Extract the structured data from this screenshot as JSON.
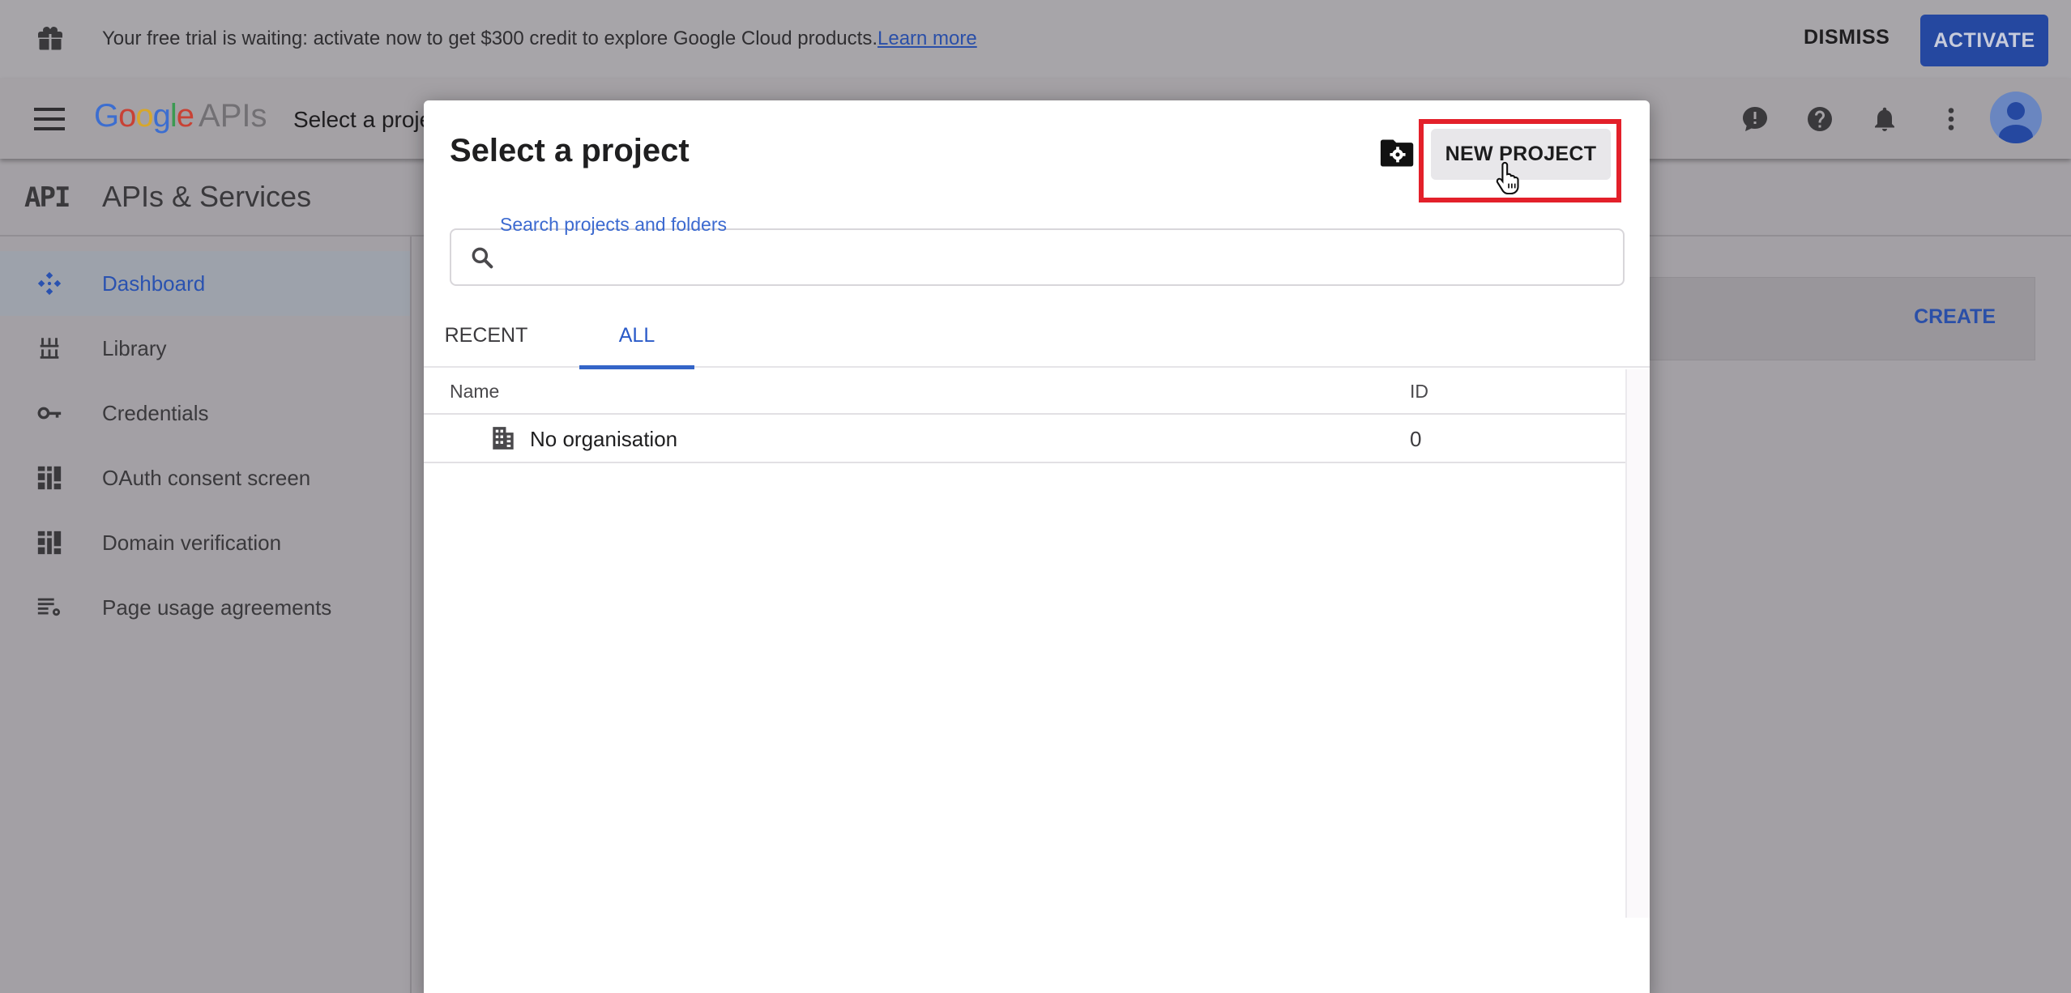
{
  "banner": {
    "message": "Your free trial is waiting: activate now to get $300 credit to explore Google Cloud products.",
    "learn_more": "Learn more",
    "dismiss": "DISMISS",
    "activate": "ACTIVATE"
  },
  "topbar": {
    "logo_google": [
      "G",
      "o",
      "o",
      "g",
      "l",
      "e"
    ],
    "logo_suffix": "APIs",
    "project_selector": "Select a proje",
    "icons": [
      "feedback-icon",
      "help-icon",
      "notifications-icon",
      "more-vert-icon",
      "account-avatar"
    ]
  },
  "subheader": {
    "badge": "API",
    "title": "APIs & Services"
  },
  "sidebar": {
    "items": [
      {
        "label": "Dashboard",
        "icon": "dashboard-icon",
        "active": true
      },
      {
        "label": "Library",
        "icon": "library-icon",
        "active": false
      },
      {
        "label": "Credentials",
        "icon": "key-icon",
        "active": false
      },
      {
        "label": "OAuth consent screen",
        "icon": "oauth-icon",
        "active": false
      },
      {
        "label": "Domain verification",
        "icon": "domain-verification-icon",
        "active": false
      },
      {
        "label": "Page usage agreements",
        "icon": "settings-list-icon",
        "active": false
      }
    ]
  },
  "main": {
    "create_label": "CREATE"
  },
  "dialog": {
    "title": "Select a project",
    "new_project": "NEW PROJECT",
    "search": {
      "label": "Search projects and folders",
      "value": "",
      "placeholder": ""
    },
    "tabs": [
      {
        "label": "RECENT",
        "selected": false
      },
      {
        "label": "ALL",
        "selected": true
      }
    ],
    "table": {
      "columns": [
        "Name",
        "ID"
      ],
      "rows": [
        {
          "name": "No organisation",
          "id": "0",
          "icon": "organization-icon"
        }
      ]
    }
  },
  "colors": {
    "accent": "#2a52b0",
    "activate_bg": "#2548a0",
    "highlight": "#e3202a",
    "overlay": "#a3a0a5"
  }
}
